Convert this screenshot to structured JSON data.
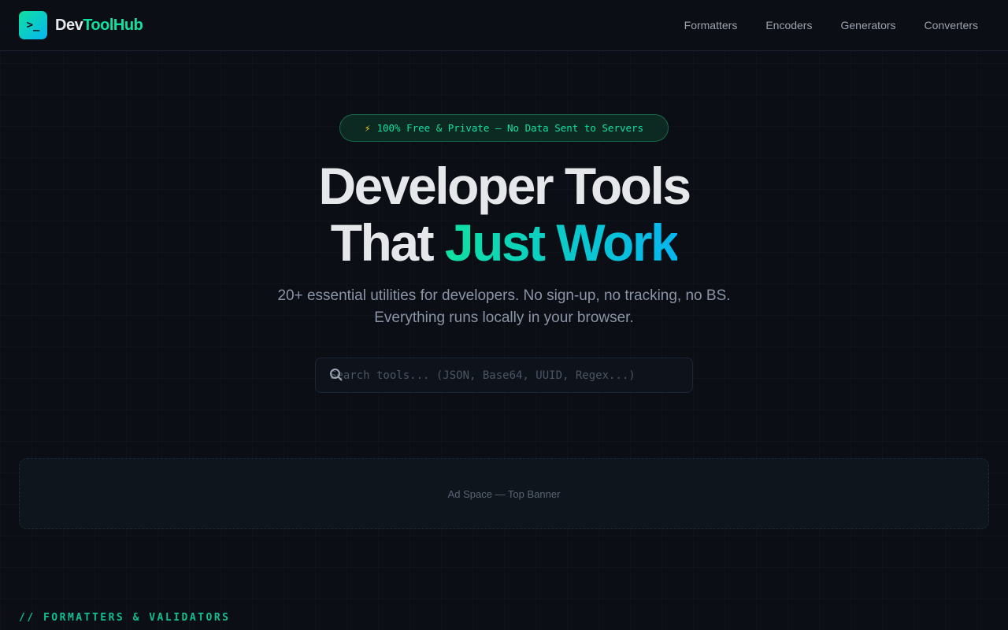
{
  "header": {
    "logo_glyph": ">_",
    "brand_part1": "Dev",
    "brand_part2": "ToolHub",
    "nav": [
      "Formatters",
      "Encoders",
      "Generators",
      "Converters"
    ]
  },
  "hero": {
    "badge_icon": "⚡",
    "badge_text": "100% Free & Private — No Data Sent to Servers",
    "title_line1": "Developer Tools",
    "title_line2_plain": "That ",
    "title_line2_accent": "Just Work",
    "subtitle_line1": "20+ essential utilities for developers. No sign-up, no tracking, no BS.",
    "subtitle_line2": "Everything runs locally in your browser.",
    "search_placeholder": "Search tools... (JSON, Base64, UUID, Regex...)",
    "search_value": ""
  },
  "ad": {
    "label": "Ad Space — Top Banner"
  },
  "section": {
    "title": "// FORMATTERS & VALIDATORS"
  },
  "colors": {
    "accent": "#10e0a0",
    "accent2": "#06b6f0",
    "bg": "#0b0e14"
  }
}
